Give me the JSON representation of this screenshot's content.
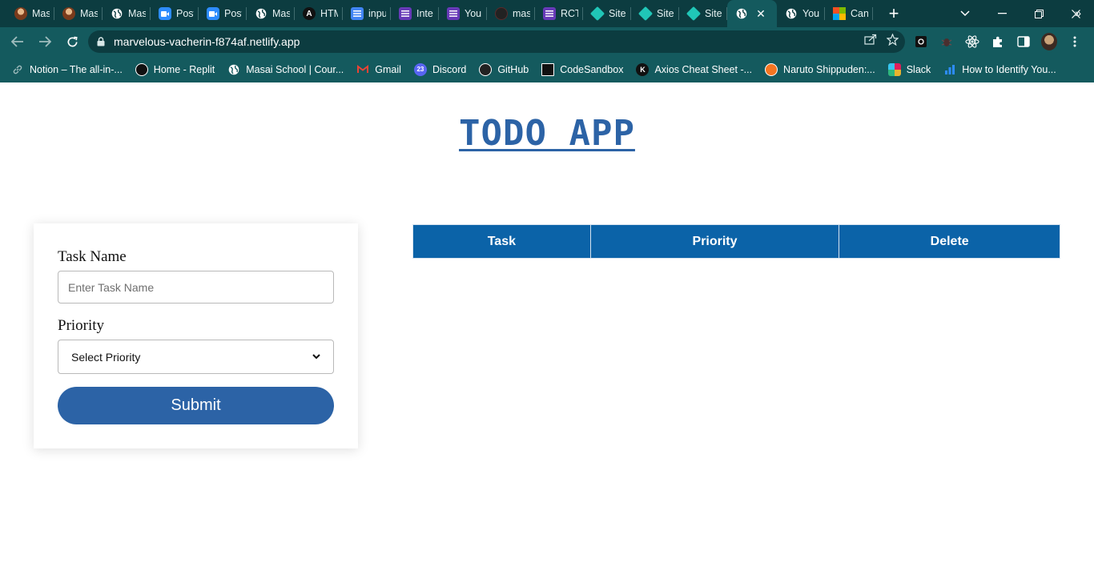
{
  "browser": {
    "tabs": [
      {
        "title": "Mas",
        "icon": "masai-icon",
        "color": "#7a3b1c"
      },
      {
        "title": "Mas",
        "icon": "masai-icon",
        "color": "#7a3b1c"
      },
      {
        "title": "Mas",
        "icon": "globe-icon",
        "color": "#ffffff"
      },
      {
        "title": "Post",
        "icon": "zoom-icon",
        "color": "#2d8cff"
      },
      {
        "title": "Post",
        "icon": "zoom-icon",
        "color": "#2d8cff"
      },
      {
        "title": "Mas",
        "icon": "globe-icon",
        "color": "#ffffff"
      },
      {
        "title": "HTM",
        "icon": "angular-icon",
        "color": "#111111"
      },
      {
        "title": "inpu",
        "icon": "docs-icon",
        "color": "#4285f4"
      },
      {
        "title": "Inte",
        "icon": "forms-icon",
        "color": "#673ab7"
      },
      {
        "title": "You",
        "icon": "forms-icon",
        "color": "#673ab7"
      },
      {
        "title": "mas",
        "icon": "github-icon",
        "color": "#222222"
      },
      {
        "title": "RCT",
        "icon": "forms-icon",
        "color": "#673ab7"
      },
      {
        "title": "Site",
        "icon": "netlify-icon",
        "color": "#20c6b7"
      },
      {
        "title": "Site",
        "icon": "netlify-icon",
        "color": "#20c6b7"
      },
      {
        "title": "Site",
        "icon": "netlify-icon",
        "color": "#20c6b7"
      },
      {
        "title": "",
        "icon": "globe-icon",
        "color": "#ffffff",
        "active": true
      },
      {
        "title": "You",
        "icon": "globe-icon",
        "color": "#ffffff"
      },
      {
        "title": "Can",
        "icon": "microsoft-icon",
        "color": "#f25022"
      }
    ],
    "url": "marvelous-vacherin-f874af.netlify.app",
    "bookmarks": [
      {
        "label": "Notion – The all-in-...",
        "icon": "link-icon",
        "color": "#145a5e"
      },
      {
        "label": "Home - Replit",
        "icon": "replit-icon",
        "color": "#111111"
      },
      {
        "label": "Masai School | Cour...",
        "icon": "globe-icon",
        "color": "#ffffff"
      },
      {
        "label": "Gmail",
        "icon": "gmail-icon",
        "color": "#ea4335"
      },
      {
        "label": "Discord",
        "icon": "discord-icon",
        "color": "#5865f2"
      },
      {
        "label": "GitHub",
        "icon": "github-icon",
        "color": "#222222"
      },
      {
        "label": "CodeSandbox",
        "icon": "codesandbox-icon",
        "color": "#111111"
      },
      {
        "label": "Axios Cheat Sheet -...",
        "icon": "k-icon",
        "color": "#111111"
      },
      {
        "label": "Naruto Shippuden:...",
        "icon": "crunchyroll-icon",
        "color": "#f47521"
      },
      {
        "label": "Slack",
        "icon": "slack-icon",
        "color": "#e01e5a"
      },
      {
        "label": "How to Identify You...",
        "icon": "chart-icon",
        "color": "#2d8cff"
      }
    ]
  },
  "app": {
    "title": "TODO APP",
    "form": {
      "task_label": "Task Name",
      "task_placeholder": "Enter Task Name",
      "priority_label": "Priority",
      "priority_selected": "Select Priority",
      "submit_label": "Submit"
    },
    "table": {
      "headers": [
        "Task",
        "Priority",
        "Delete"
      ]
    }
  },
  "colors": {
    "accent": "#2c63a6",
    "table_header": "#0b63a8",
    "chrome": "#145a5e"
  }
}
